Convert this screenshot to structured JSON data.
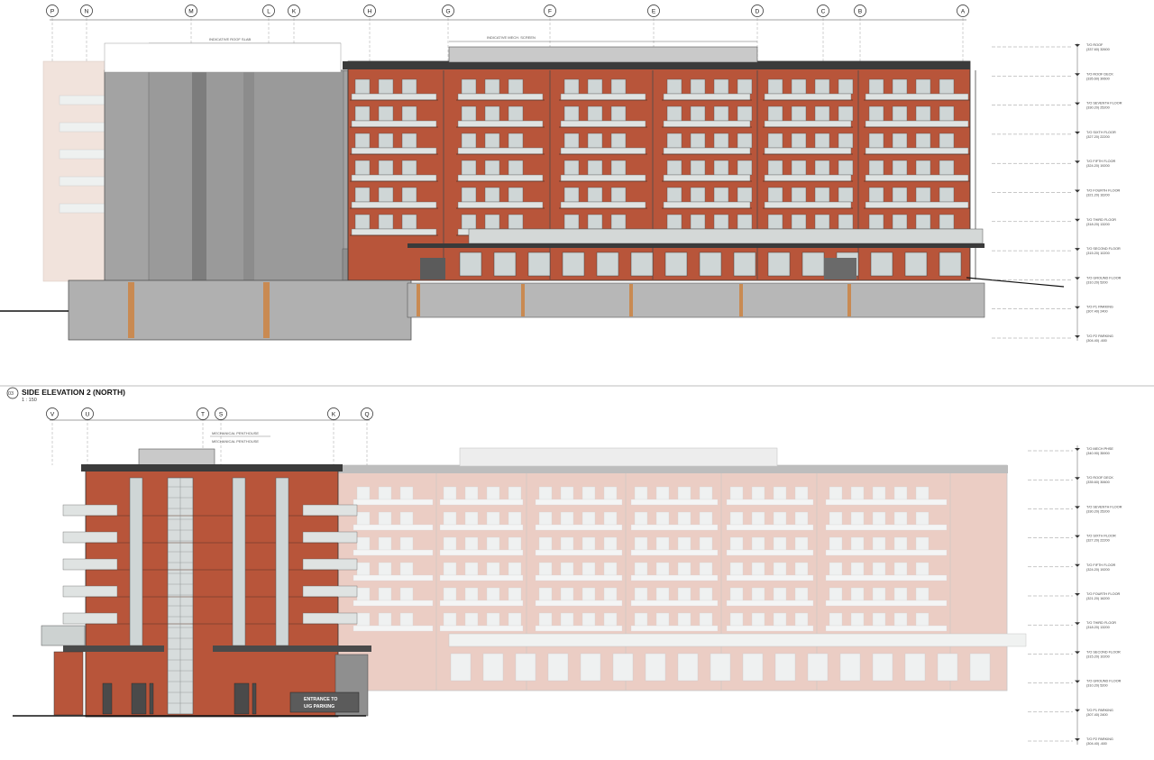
{
  "drawing": {
    "title": "SIDE ELEVATION 2 (NORTH)",
    "scale": "1 : 150",
    "title_marker": "03"
  },
  "elevation_1": {
    "grid_lines": [
      "P",
      "N",
      "M",
      "L",
      "K",
      "H",
      "G",
      "F",
      "E",
      "D",
      "C",
      "B",
      "A"
    ],
    "notes": [
      "INDICATIVE ROOF SLAB",
      "INDICATIVE MECH. SCREEN"
    ],
    "levels": [
      {
        "name": "T/O ROOF",
        "elev": "(337.60) 32600"
      },
      {
        "name": "T/O ROOF DECK",
        "elev": "(335.60) 30600"
      },
      {
        "name": "T/O SEVENTH FLOOR",
        "elev": "(330.20) 25200"
      },
      {
        "name": "T/O SIXTH FLOOR",
        "elev": "(327.20) 22200"
      },
      {
        "name": "T/O FIFTH FLOOR",
        "elev": "(324.20) 19200"
      },
      {
        "name": "T/O FOURTH FLOOR",
        "elev": "(321.20) 16200"
      },
      {
        "name": "T/O THIRD FLOOR",
        "elev": "(318.20) 13200"
      },
      {
        "name": "T/O SECOND FLOOR",
        "elev": "(315.20) 10200"
      },
      {
        "name": "T/O GROUND FLOOR",
        "elev": "(310.20) 5200"
      },
      {
        "name": "T/O P1 PARKING",
        "elev": "(307.40) 2400"
      },
      {
        "name": "T/O P2 PARKING",
        "elev": "(304.40) -600"
      }
    ]
  },
  "elevation_2": {
    "grid_lines": [
      "V",
      "U",
      "T",
      "S",
      "K",
      "Q"
    ],
    "notes": [
      "MECHANICAL PENTHOUSE",
      "MECHANICAL PENTHOUSE"
    ],
    "sign": [
      "ENTRANCE TO",
      "U/G PARKING"
    ],
    "levels": [
      {
        "name": "T/O MECH PHSE",
        "elev": "(340.90) 35900"
      },
      {
        "name": "T/O ROOF DECK",
        "elev": "(335.60) 30600"
      },
      {
        "name": "T/O SEVENTH FLOOR",
        "elev": "(330.20) 25200"
      },
      {
        "name": "T/O SIXTH FLOOR",
        "elev": "(327.20) 22200"
      },
      {
        "name": "T/O FIFTH FLOOR",
        "elev": "(324.20) 19200"
      },
      {
        "name": "T/O FOURTH FLOOR",
        "elev": "(321.20) 16200"
      },
      {
        "name": "T/O THIRD FLOOR",
        "elev": "(318.20) 13200"
      },
      {
        "name": "T/O SECOND FLOOR",
        "elev": "(315.20) 10200"
      },
      {
        "name": "T/O GROUND FLOOR",
        "elev": "(310.20) 5200"
      },
      {
        "name": "T/O P1 PARKING",
        "elev": "(307.40) 2400"
      },
      {
        "name": "T/O P2 PARKING",
        "elev": "(304.40) -600"
      }
    ]
  },
  "colors": {
    "brick": "#b8553a",
    "brick_dark": "#8e3f2b",
    "grey_panel": "#9c9c9c",
    "grey_dark": "#6d6d6d",
    "glass": "#cfd6d6",
    "balcony": "#dfe3e2",
    "ghost": "#f2d9d0",
    "roof": "#3b3b3b",
    "line": "#333333"
  }
}
